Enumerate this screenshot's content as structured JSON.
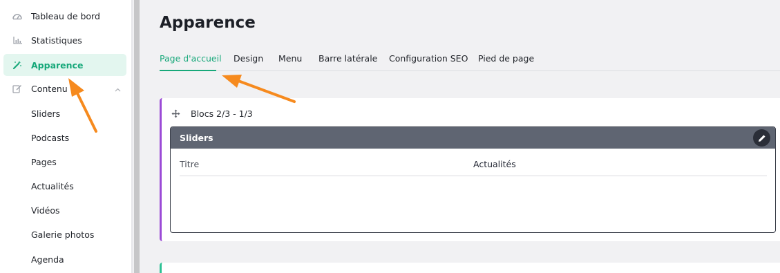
{
  "sidebar": {
    "items": [
      {
        "label": "Tableau de bord",
        "icon": "dashboard-icon"
      },
      {
        "label": "Statistiques",
        "icon": "chart-icon"
      },
      {
        "label": "Apparence",
        "icon": "magic-wand-icon",
        "active": true
      },
      {
        "label": "Contenu",
        "icon": "edit-icon",
        "expanded": true
      }
    ],
    "subitems": [
      "Sliders",
      "Podcasts",
      "Pages",
      "Actualités",
      "Vidéos",
      "Galerie photos",
      "Agenda"
    ]
  },
  "main": {
    "title": "Apparence",
    "tabs": [
      "Page d'accueil",
      "Design",
      "Menu",
      "Barre latérale",
      "Configuration SEO",
      "Pied de page"
    ],
    "active_tab": "Page d'accueil",
    "card": {
      "heading": "Blocs 2/3 - 1/3",
      "block": {
        "title": "Sliders",
        "field_label": "Titre",
        "field_value": "Actualités"
      }
    }
  },
  "colors": {
    "accent": "#17a87a",
    "card_border": "#9b4ad6",
    "card2_border": "#2cc194",
    "block_header": "#5f6572",
    "annotation_arrow": "#f68a1e"
  }
}
